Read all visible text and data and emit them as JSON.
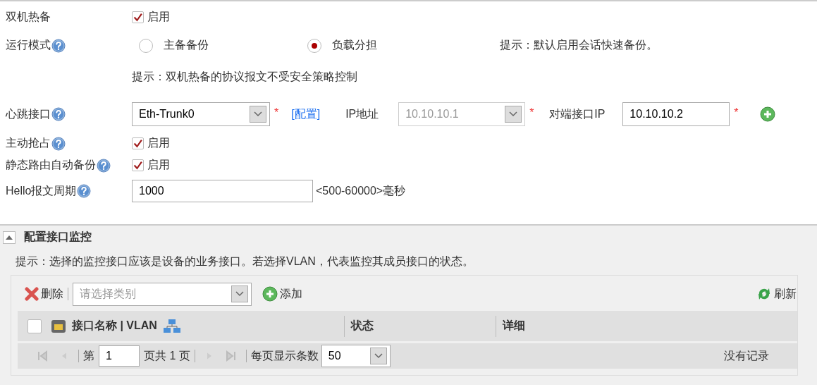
{
  "form": {
    "hot_standby": {
      "label": "双机热备",
      "option": "启用",
      "checked": true
    },
    "mode": {
      "label": "运行模式",
      "options": [
        {
          "label": "主备备份",
          "selected": false
        },
        {
          "label": "负载分担",
          "selected": true
        }
      ],
      "hint": "提示：默认启用会话快速备份。"
    },
    "protocol_hint": "提示：双机热备的协议报文不受安全策略控制",
    "heartbeat": {
      "label": "心跳接口",
      "interface": "Eth-Trunk0",
      "required": "*",
      "config_link": "[配置]",
      "ip_label": "IP地址",
      "ip_value": "10.10.10.1",
      "ip_disabled": true,
      "ip_required": "*",
      "peer_label": "对端接口IP",
      "peer_value": "10.10.10.2",
      "peer_required": "*"
    },
    "preempt": {
      "label": "主动抢占",
      "option": "启用",
      "checked": true
    },
    "static_route_backup": {
      "label": "静态路由自动备份",
      "option": "启用",
      "checked": true
    },
    "hello": {
      "label": "Hello报文周期",
      "value": "1000",
      "range": "<500-60000>毫秒"
    }
  },
  "monitor": {
    "title": "配置接口监控",
    "expanded": true,
    "hint": "提示：选择的监控接口应该是设备的业务接口。若选择VLAN，代表监控其成员接口的状态。",
    "toolbar": {
      "delete": "删除",
      "category_placeholder": "请选择类别",
      "add": "添加",
      "refresh": "刷新"
    },
    "table": {
      "select_all_checked": false,
      "columns": [
        "接口名称 | VLAN",
        "状态",
        "详细"
      ]
    },
    "pager": {
      "page_prefix": "第",
      "page": "1",
      "page_suffix": "页共 1 页",
      "page_size_label": "每页显示条数",
      "page_size": "50",
      "empty": "没有记录"
    }
  }
}
